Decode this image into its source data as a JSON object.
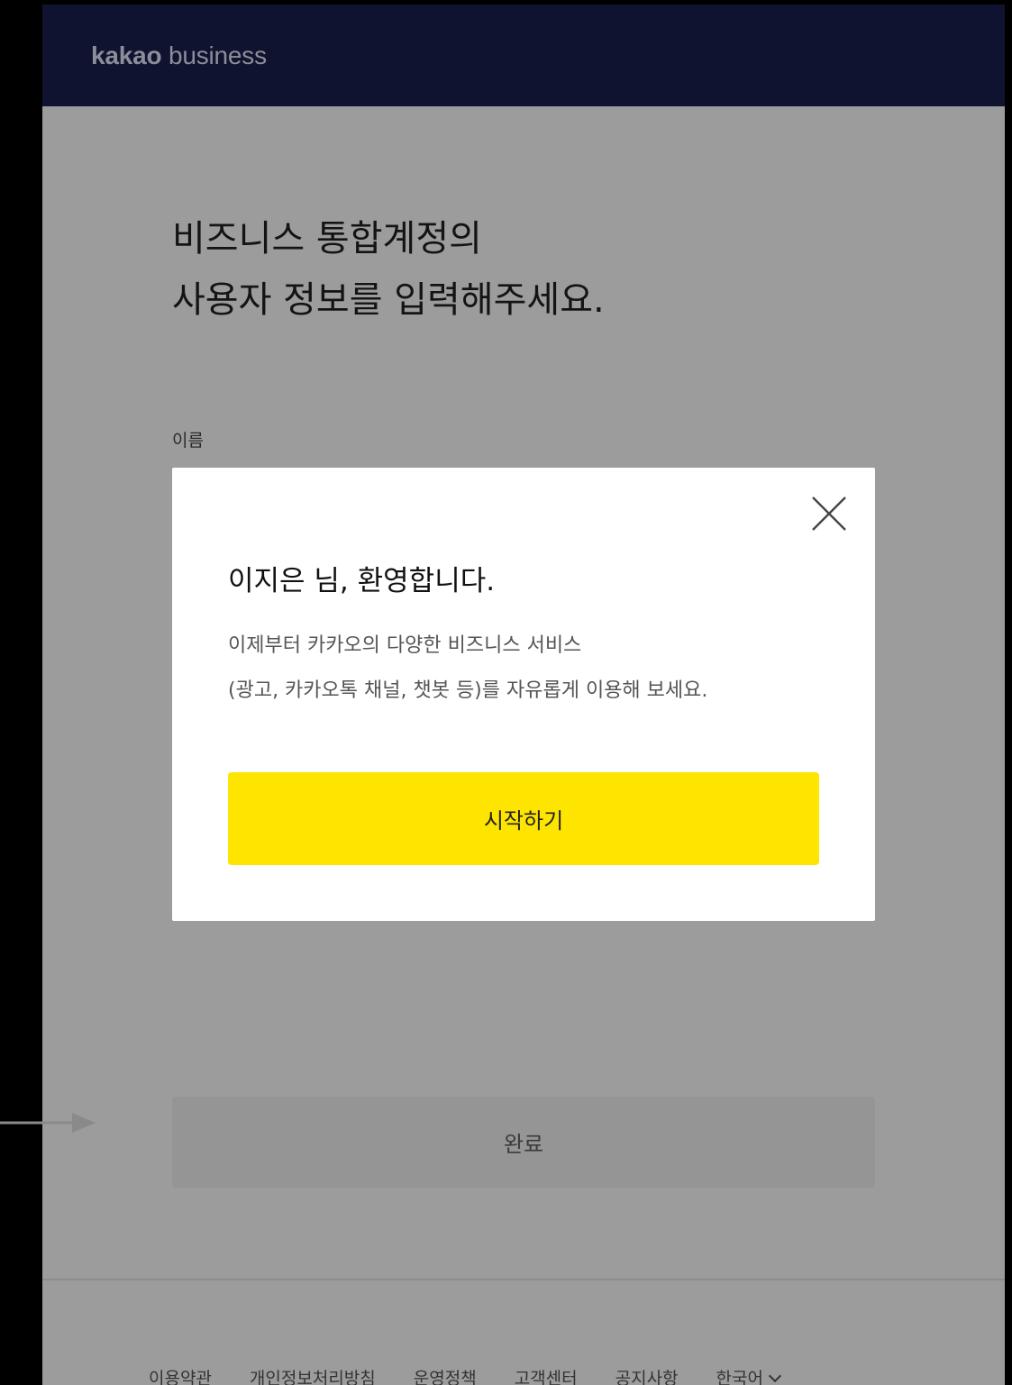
{
  "header": {
    "brand_bold": "kakao",
    "brand_light": " business"
  },
  "page": {
    "title_line1": "비즈니스 통합계정의",
    "title_line2": "사용자 정보를 입력해주세요.",
    "name_label": "이름",
    "done_label": "완료"
  },
  "modal": {
    "title": "이지은 님, 환영합니다.",
    "desc_line1": "이제부터 카카오의 다양한 비즈니스 서비스",
    "desc_line2": "(광고, 카카오톡 채널, 챗봇 등)를 자유롭게 이용해 보세요.",
    "start_label": "시작하기"
  },
  "footer": {
    "links": [
      "이용약관",
      "개인정보처리방침",
      "운영정책",
      "고객센터",
      "공지사항"
    ],
    "language": "한국어"
  },
  "colors": {
    "header_bg": "#101330",
    "accent_yellow": "#fee500",
    "dim_overlay_bg": "#9c9c9c"
  }
}
